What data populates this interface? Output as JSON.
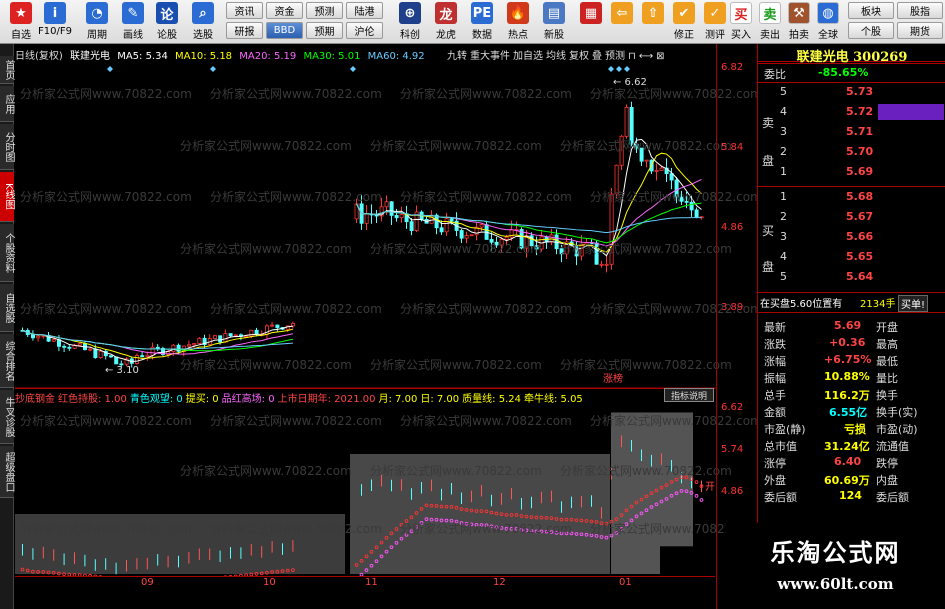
{
  "toolbar": {
    "buttons": [
      {
        "label": "自选",
        "icon": "star-icon",
        "color": "#d22"
      },
      {
        "label": "F10/F9",
        "icon": "info-icon",
        "color": "#2a6bd4"
      },
      {
        "label": "周期",
        "icon": "clock-icon",
        "color": "#2a6bd4"
      },
      {
        "label": "画线",
        "icon": "pencil-icon",
        "color": "#2a6bd4"
      },
      {
        "label": "论股",
        "icon": "chat-icon",
        "color": "#1a4fb0"
      },
      {
        "label": "选股",
        "icon": "magnifier-icon",
        "color": "#2a6bd4"
      }
    ],
    "mid_buttons_top": [
      "资讯",
      "资金",
      "预测",
      "陆港"
    ],
    "mid_buttons_bottom": [
      "研报",
      "BBD",
      "预期",
      "沪伦"
    ],
    "right_buttons": [
      {
        "label": "科创",
        "icon": "rocket-icon"
      },
      {
        "label": "龙虎",
        "icon": "dragon-icon"
      },
      {
        "label": "数据",
        "icon": "pe-icon"
      },
      {
        "label": "热点",
        "icon": "flame-icon"
      },
      {
        "label": "新股",
        "icon": "document-icon"
      }
    ],
    "nav_buttons": [
      {
        "label": "",
        "icon": "grid-icon"
      },
      {
        "label": "",
        "icon": "back-arrow-icon"
      },
      {
        "label": "",
        "icon": "up-icon"
      },
      {
        "label": "修正",
        "icon": "check-icon"
      },
      {
        "label": "测评",
        "icon": "score-icon"
      }
    ],
    "trade_buttons": [
      {
        "label": "买入",
        "icon": "buy-icon"
      },
      {
        "label": "卖出",
        "icon": "sell-icon"
      },
      {
        "label": "拍卖",
        "icon": "auction-icon"
      },
      {
        "label": "全球",
        "icon": "globe-icon"
      }
    ],
    "far_right_top": [
      "板块",
      "股指"
    ],
    "far_right_bottom": [
      "个股",
      "期货"
    ],
    "buy_char": "买",
    "sell_char": "卖"
  },
  "left_tabs": [
    "首页",
    "应用",
    "分时图",
    "K线图",
    "个股资料",
    "自选股",
    "综合排名",
    "牛叉诊股",
    "超级盘口"
  ],
  "chart_header": {
    "period": "日线(复权)",
    "stock_name": "联建光电",
    "ma5": "MA5: 5.34",
    "ma10": "MA10: 5.18",
    "ma20": "MA20: 5.19",
    "ma30": "MA30: 5.01",
    "ma60": "MA60: 4.92",
    "colors": {
      "ma5": "#ffffff",
      "ma10": "#ffff00",
      "ma20": "#ff66ff",
      "ma30": "#00ff00",
      "ma60": "#66ccff"
    },
    "right_menu": [
      "九转",
      "重大事件",
      "加自选",
      "均线",
      "复权",
      "叠",
      "预测"
    ]
  },
  "axis_labels": [
    "6.82",
    "5.84",
    "4.86",
    "3.89"
  ],
  "indicator_axis_labels": [
    "6.62",
    "5.74",
    "4.86"
  ],
  "annotations": {
    "high": "6.62",
    "low": "3.10",
    "zhang_ting": "涨榜",
    "kai": "开"
  },
  "indicator_header": {
    "name": "抄底钢金",
    "items": [
      "红色持股: 1.00",
      "青色观望: 0",
      "提买: 0",
      "品红高场: 0",
      "上市日期年: 2021.00",
      "月: 7.00",
      "日: 7.00",
      "质量线: 5.24",
      "牵牛线: 5.05"
    ],
    "button": "指标说明"
  },
  "x_axis": [
    "09",
    "10",
    "11",
    "12",
    "01"
  ],
  "panel": {
    "title": "联建光电  300269",
    "weibi_label": "委比",
    "weibi_value": "-85.65%",
    "sell_label": [
      "卖",
      "盘"
    ],
    "sell_orders": [
      {
        "level": "5",
        "price": "5.73"
      },
      {
        "level": "4",
        "price": "5.72"
      },
      {
        "level": "3",
        "price": "5.71"
      },
      {
        "level": "2",
        "price": "5.70"
      },
      {
        "level": "1",
        "price": "5.69"
      }
    ],
    "buy_label": [
      "买",
      "盘"
    ],
    "buy_orders": [
      {
        "level": "1",
        "price": "5.68"
      },
      {
        "level": "2",
        "price": "5.67"
      },
      {
        "level": "3",
        "price": "5.66"
      },
      {
        "level": "4",
        "price": "5.65"
      },
      {
        "level": "5",
        "price": "5.64"
      }
    ],
    "order_note": "在买盘5.60位置有",
    "order_note_qty": "2134手",
    "order_note_action": "买单!",
    "stats": [
      {
        "l": "最新",
        "v": "5.69",
        "r": "开盘"
      },
      {
        "l": "涨跌",
        "v": "+0.36",
        "r": "最高"
      },
      {
        "l": "涨幅",
        "v": "+6.75%",
        "r": "最低"
      },
      {
        "l": "振幅",
        "v": "10.88%",
        "r": "量比"
      },
      {
        "l": "总手",
        "v": "116.2万",
        "r": "换手"
      },
      {
        "l": "金额",
        "v": "6.55亿",
        "r": "换手(实)"
      },
      {
        "l": "市盈(静)",
        "v": "亏损",
        "r": "市盈(动)"
      },
      {
        "l": "总市值",
        "v": "31.24亿",
        "r": "流通值"
      },
      {
        "l": "涨停",
        "v": "6.40",
        "r": "跌停"
      },
      {
        "l": "外盘",
        "v": "60.69万",
        "r": "内盘"
      },
      {
        "l": "委后额",
        "v": "124",
        "r": "委后额"
      }
    ]
  },
  "background_watermark": "分析家公式网www.70822.com",
  "watermark": {
    "title": "乐淘公式网",
    "url": "www.60lt.com"
  },
  "chart_data": {
    "type": "candlestick",
    "title": "",
    "ylim": [
      3.0,
      6.9
    ],
    "x_ticks": [
      "09",
      "10",
      "11",
      "12",
      "01"
    ],
    "high_marker": 6.62,
    "low_marker": 3.1,
    "candles_summary": "daily K-line, prices from ~3.1 to ~6.62"
  }
}
